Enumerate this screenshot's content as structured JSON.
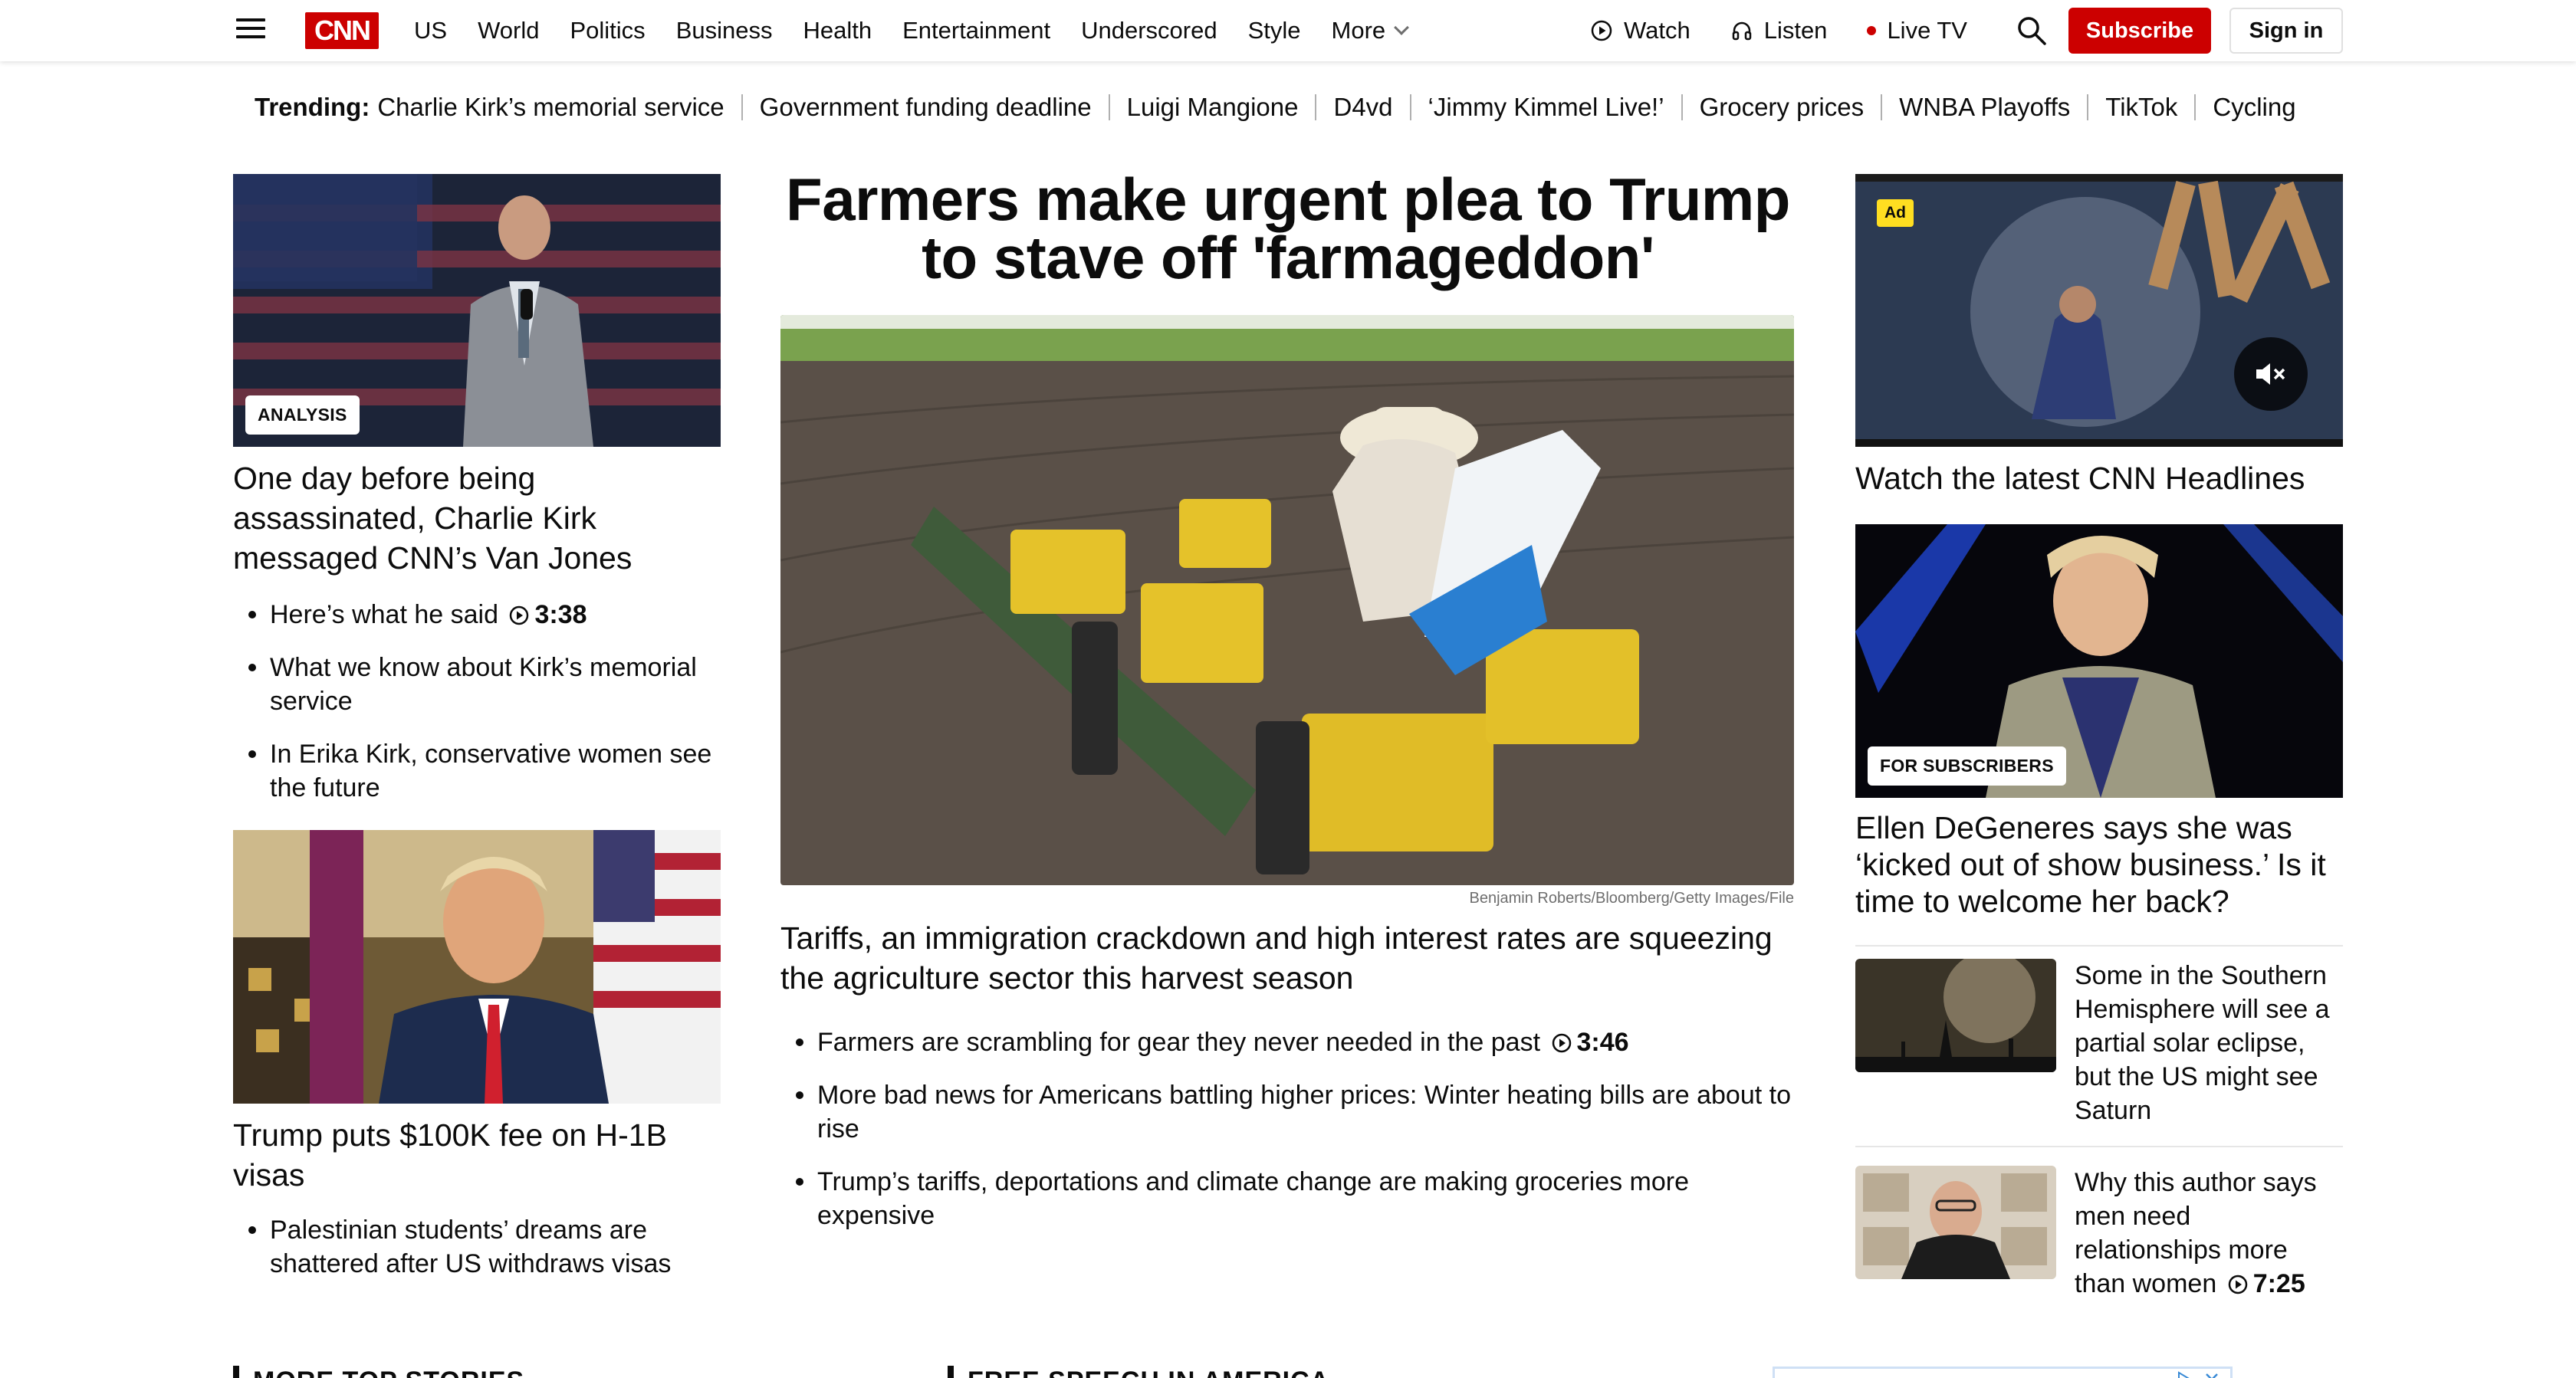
{
  "header": {
    "logo": "CNN",
    "nav": [
      "US",
      "World",
      "Politics",
      "Business",
      "Health",
      "Entertainment",
      "Underscored",
      "Style"
    ],
    "more": "More",
    "watch": "Watch",
    "listen": "Listen",
    "live_tv": "Live TV",
    "subscribe": "Subscribe",
    "sign_in": "Sign in"
  },
  "trending": {
    "label": "Trending:",
    "items": [
      "Charlie Kirk’s memorial service",
      "Government funding deadline",
      "Luigi Mangione",
      "D4vd",
      "‘Jimmy Kimmel Live!’",
      "Grocery prices",
      "WNBA Playoffs",
      "TikTok",
      "Cycling"
    ]
  },
  "left": {
    "story1": {
      "badge": "ANALYSIS",
      "headline": "One day before being assassinated, Charlie Kirk messaged CNN’s Van Jones",
      "bullets": [
        {
          "text": "Here’s what he said",
          "duration": "3:38"
        },
        {
          "text": "What we know about Kirk’s memorial service",
          "duration": ""
        },
        {
          "text": "In Erika Kirk, conservative women see the future",
          "duration": ""
        }
      ]
    },
    "story2": {
      "headline": "Trump puts $100K fee on H-1B visas",
      "bullets": [
        {
          "text": "Palestinian students’ dreams are shattered after US withdraws visas",
          "duration": ""
        }
      ]
    }
  },
  "center": {
    "title": "Farmers make urgent plea to Trump to stave off 'farmageddon'",
    "photo_credit": "Benjamin Roberts/Bloomberg/Getty Images/File",
    "sub_headline": "Tariffs, an immigration crackdown and high interest rates are squeezing the agriculture sector this harvest season",
    "bullets": [
      {
        "text": "Farmers are scrambling for gear they never needed in the past",
        "duration": "3:46"
      },
      {
        "text": "More bad news for Americans battling higher prices: Winter heating bills are about to rise",
        "duration": ""
      },
      {
        "text": "Trump’s tariffs, deportations and climate change are making groceries more expensive",
        "duration": ""
      }
    ]
  },
  "right": {
    "ad_label": "Ad",
    "video_headline": "Watch the latest CNN Headlines",
    "feature_badge": "FOR SUBSCRIBERS",
    "feature_headline": "Ellen DeGeneres says she was ‘kicked out of show business.’ Is it time to welcome her back?",
    "small_stories": [
      {
        "text": "Some in the Southern Hemisphere will see a partial solar eclipse, but the US might see Saturn",
        "duration": ""
      },
      {
        "text": "Why this author says men need relationships more than women",
        "duration": "7:25"
      }
    ]
  },
  "sections": {
    "more_top_stories": "MORE TOP STORIES",
    "free_speech": "FREE SPEECH IN AMERICA"
  },
  "colors": {
    "brand_red": "#cc0000",
    "ad_yellow": "#ffde21"
  }
}
